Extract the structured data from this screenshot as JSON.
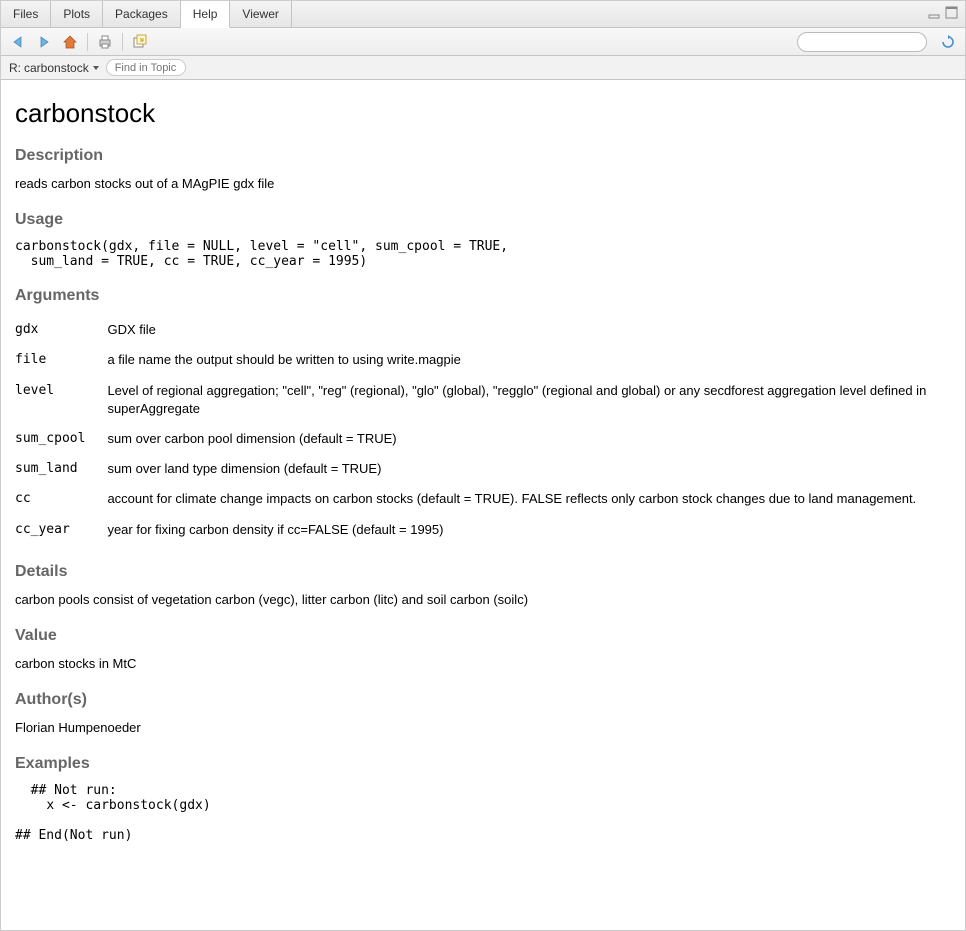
{
  "tabs": {
    "files": "Files",
    "plots": "Plots",
    "packages": "Packages",
    "help": "Help",
    "viewer": "Viewer"
  },
  "subtoolbar": {
    "topic_prefix": "R: ",
    "topic_name": "carbonstock",
    "find_placeholder": "Find in Topic"
  },
  "search": {
    "placeholder": ""
  },
  "doc": {
    "title": "carbonstock",
    "sections": {
      "description_h": "Description",
      "description_t": "reads carbon stocks out of a MAgPIE gdx file",
      "usage_h": "Usage",
      "usage_code": "carbonstock(gdx, file = NULL, level = \"cell\", sum_cpool = TRUE,\n  sum_land = TRUE, cc = TRUE, cc_year = 1995)",
      "arguments_h": "Arguments",
      "args": [
        {
          "name": "gdx",
          "desc": "GDX file"
        },
        {
          "name": "file",
          "desc": "a file name the output should be written to using write.magpie"
        },
        {
          "name": "level",
          "desc": "Level of regional aggregation; \"cell\", \"reg\" (regional), \"glo\" (global), \"regglo\" (regional and global) or any secdforest aggregation level defined in superAggregate"
        },
        {
          "name": "sum_cpool",
          "desc": "sum over carbon pool dimension (default = TRUE)"
        },
        {
          "name": "sum_land",
          "desc": "sum over land type dimension (default = TRUE)"
        },
        {
          "name": "cc",
          "desc": "account for climate change impacts on carbon stocks (default = TRUE). FALSE reflects only carbon stock changes due to land management."
        },
        {
          "name": "cc_year",
          "desc": "year for fixing carbon density if cc=FALSE (default = 1995)"
        }
      ],
      "details_h": "Details",
      "details_t": "carbon pools consist of vegetation carbon (vegc), litter carbon (litc) and soil carbon (soilc)",
      "value_h": "Value",
      "value_t": "carbon stocks in MtC",
      "author_h": "Author(s)",
      "author_t": "Florian Humpenoeder",
      "examples_h": "Examples",
      "examples_code": "  ## Not run: \n    x <- carbonstock(gdx)\n  \n## End(Not run)"
    }
  }
}
